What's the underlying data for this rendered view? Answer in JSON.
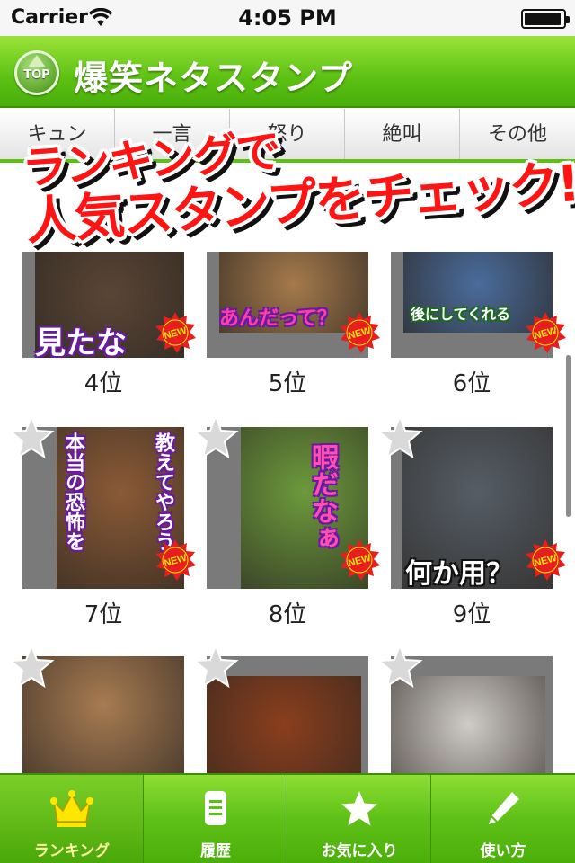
{
  "status_bar": {
    "carrier": "Carrier",
    "time": "4:05 PM",
    "battery_level": 0.95
  },
  "header": {
    "top_button_label": "TOP",
    "title": "爆笑ネタスタンプ"
  },
  "category_tabs": [
    "キュン",
    "一言",
    "怒り",
    "絶叫",
    "その他"
  ],
  "promo_banner": {
    "line1": "ランキングで",
    "line2": "人気スタンプをチェック!!"
  },
  "items": [
    {
      "rank": "4位",
      "caption": "見たな",
      "badge": "NEW",
      "caption_color": "#ffffff",
      "photo_color": "#5a4535"
    },
    {
      "rank": "5位",
      "caption": "あんだって？",
      "badge": "NEW",
      "caption_color": "#ff3fa8",
      "photo_color": "#a57a4c"
    },
    {
      "rank": "6位",
      "caption": "後にしてくれる",
      "badge": "NEW",
      "caption_color": "#ffffff",
      "photo_color": "#4a6c9c"
    },
    {
      "rank": "7位",
      "caption": "本当の恐怖を",
      "caption2": "教えてやろう",
      "badge": "NEW",
      "caption_color": "#ffffff",
      "photo_color": "#8a5a36"
    },
    {
      "rank": "8位",
      "caption": "暇だなぁ",
      "badge": "NEW",
      "caption_color": "#ff4fb0",
      "photo_color": "#6c9a3c"
    },
    {
      "rank": "9位",
      "caption": "何か用？",
      "badge": "NEW",
      "caption_color": "#ffffff",
      "photo_color": "#555d66"
    },
    {
      "rank": "",
      "caption": "",
      "badge": "",
      "photo_color": "#a77b52"
    },
    {
      "rank": "",
      "caption": "",
      "badge": "",
      "photo_color": "#8a3e1e"
    },
    {
      "rank": "",
      "caption": "",
      "badge": "",
      "photo_color": "#cfcbc6"
    }
  ],
  "tab_bar": [
    {
      "label": "ランキング",
      "icon": "crown-icon",
      "selected": true
    },
    {
      "label": "履歴",
      "icon": "document-icon",
      "selected": false
    },
    {
      "label": "お気に入り",
      "icon": "star-icon",
      "selected": false
    },
    {
      "label": "使い方",
      "icon": "pencil-icon",
      "selected": false
    }
  ],
  "colors": {
    "accent_green": "#5cc113",
    "promo_red": "#ff1414",
    "new_badge_red": "#e61e1e",
    "new_badge_yellow": "#ffe600"
  }
}
